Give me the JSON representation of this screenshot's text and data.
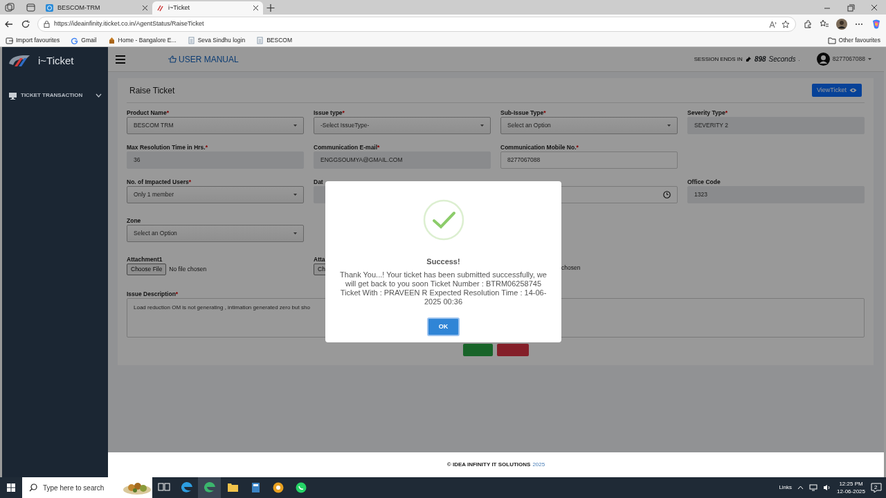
{
  "browser": {
    "tabs": [
      {
        "title": "BESCOM-TRM",
        "selected": false
      },
      {
        "title": "i~Ticket",
        "selected": true
      }
    ],
    "url": "https://ideainfinity.iticket.co.in/AgentStatus/RaiseTicket",
    "bookmarks": [
      "Import favourites",
      "Gmail",
      "Home - Bangalore E...",
      "Seva Sindhu login",
      "BESCOM"
    ],
    "other_favourites": "Other favourites"
  },
  "sidebar": {
    "logo": "i~Ticket",
    "items": [
      {
        "label": "TICKET TRANSACTION",
        "expanded": false
      }
    ]
  },
  "header": {
    "user_manual": "USER MANUAL",
    "session_label": "SESSION ENDS IN",
    "session_count": "898",
    "session_unit": "Seconds",
    "session_tail": ".",
    "user": "8277067088"
  },
  "page": {
    "title": "Raise Ticket",
    "view_button": "ViewTicket",
    "rows": [
      [
        {
          "kind": "select",
          "label": "Product Name",
          "required_mark": "*",
          "value": "BESCOM TRM"
        },
        {
          "kind": "select",
          "label": "Issue type",
          "required_mark": "*",
          "value": "-Select IssueType-"
        },
        {
          "kind": "select",
          "label": "Sub-Issue Type",
          "required_mark": "*",
          "value": "Select an Option"
        },
        {
          "kind": "readonly",
          "label": "Severity Type",
          "required_mark": "*",
          "value": "SEVERITY 2"
        }
      ],
      [
        {
          "kind": "readonly",
          "label": "Max Resolution Time in Hrs.",
          "required_mark": "*",
          "value": "36"
        },
        {
          "kind": "readonly",
          "label": "Communication E-mail",
          "required_mark": "*",
          "value": "ENGGSOUMYA@GMAIL.COM"
        },
        {
          "kind": "input",
          "label": "Communication Mobile No.",
          "required_mark": "*",
          "value": "8277067088"
        }
      ],
      [
        {
          "kind": "select",
          "label": "No. of Impacted Users",
          "required_mark": "*",
          "value": "Only 1 member"
        },
        {
          "kind": "date",
          "label": "Dat"
        },
        {
          "kind": "time"
        },
        {
          "kind": "readonly",
          "label": "Office Code",
          "value": "1323"
        }
      ],
      [
        {
          "kind": "select",
          "label": "Zone",
          "value": "Select an Option"
        }
      ],
      [
        {
          "kind": "file",
          "label": "Attachment1",
          "button": "Choose File",
          "status": "No file chosen"
        },
        {
          "kind": "file",
          "label": "Atta",
          "button": "Ch"
        },
        {
          "kind": "file",
          "status": "chosen"
        }
      ]
    ],
    "description": {
      "label": "Issue Description",
      "required_mark": "*",
      "value": "Load reduction OM is not generating , intimation generated zero but sho"
    }
  },
  "dialog": {
    "title": "Success!",
    "message": "Thank You...! Your ticket has been submitted successfully, we will get back to you soon Ticket Number : BTRM06258745 Ticket With : PRAVEEN R Expected Resolution Time : 14-06-2025 00:36",
    "ok": "OK"
  },
  "footer": {
    "text": "© IDEA INFINITY IT SOLUTIONS",
    "year": "2025"
  },
  "taskbar": {
    "search_placeholder": "Type here to search",
    "links": "Links",
    "time": "12:25 PM",
    "date": "12-06-2025",
    "notifications": "2"
  }
}
